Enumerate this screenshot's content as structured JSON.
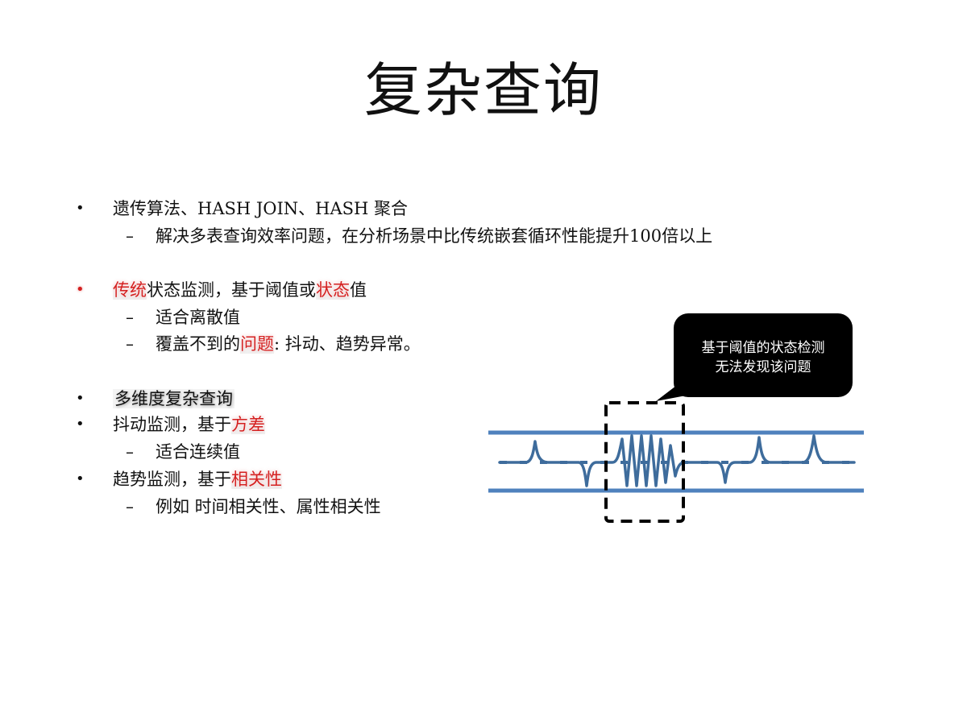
{
  "slide": {
    "title": "复杂查询"
  },
  "bullets": {
    "item1": {
      "bullet": "•",
      "text": "遗传算法、HASH JOIN、HASH 聚合",
      "sub1": {
        "dash": "–",
        "text": "解决多表查询效率问题，在分析场景中比传统嵌套循环性能提升100倍以上"
      }
    },
    "item2": {
      "bullet": "•",
      "text_a": "传统",
      "text_b": "状态监测，基于阈值或",
      "text_c": "状态",
      "text_d": "值",
      "sub1": {
        "dash": "–",
        "text": "适合离散值"
      },
      "sub2": {
        "dash": "–",
        "text_a": "覆盖不到的",
        "text_b": "问题",
        "text_c": ": 抖动、趋势异常。"
      }
    },
    "item3": {
      "bullet": "•",
      "text": "多维度复杂查询"
    },
    "item4": {
      "bullet": "•",
      "text_a": "抖动监测，基于",
      "text_b": "方差",
      "sub1": {
        "dash": "–",
        "text": "适合连续值"
      }
    },
    "item5": {
      "bullet": "•",
      "text_a": "趋势监测，基于",
      "text_b": "相关性",
      "sub1": {
        "dash": "–",
        "text": "例如 时间相关性、属性相关性"
      }
    }
  },
  "diagram": {
    "callout_line1": "基于阈值的状态检测",
    "callout_line2": "无法发现该问题",
    "threshold_color": "#4f81bd",
    "signal_color": "#3e6c9c",
    "box_color": "#000000"
  }
}
